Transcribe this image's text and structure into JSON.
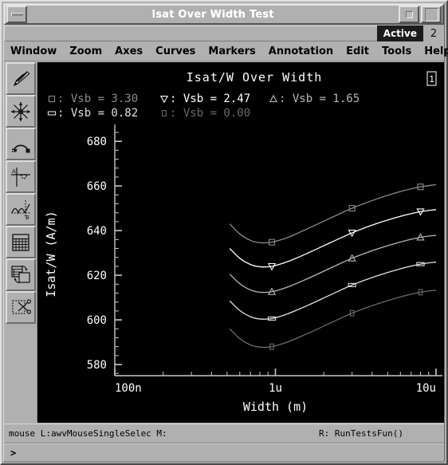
{
  "window": {
    "title": "Isat Over Width Test",
    "minimize_icon": "minimize-icon",
    "maximize_icon": "maximize-icon",
    "restore_icon": "restore-icon"
  },
  "status_strip": {
    "active_label": "Active",
    "window_number": "2"
  },
  "menubar": {
    "items": [
      {
        "label": "Window"
      },
      {
        "label": "Zoom"
      },
      {
        "label": "Axes"
      },
      {
        "label": "Curves"
      },
      {
        "label": "Markers"
      },
      {
        "label": "Annotation"
      },
      {
        "label": "Edit"
      },
      {
        "label": "Tools"
      }
    ],
    "help_label": "Help"
  },
  "toolbar": {
    "items": [
      {
        "icon": "probe-icon",
        "name": "probe-tool"
      },
      {
        "icon": "snap-crosshair-icon",
        "name": "snap-tool"
      },
      {
        "icon": "swap-arrow-icon",
        "name": "swap-tool"
      },
      {
        "icon": "ab-axis-icon",
        "name": "ab-axis-tool"
      },
      {
        "icon": "waveform-b-icon",
        "name": "waveform-b-tool"
      },
      {
        "icon": "table-icon",
        "name": "table-tool"
      },
      {
        "icon": "copy-windows-icon",
        "name": "copy-tool"
      },
      {
        "icon": "scissors-icon",
        "name": "delete-tool"
      }
    ]
  },
  "plot": {
    "corner_label": "1",
    "legend_lines": [
      {
        "marker": "square",
        "text": ":  Vsb  =  3.30",
        "color": "#8a8a8a"
      },
      {
        "marker": "down-triangle",
        "text": ":  Vsb  =  2.47",
        "color": "#ffffff"
      },
      {
        "marker": "up-triangle",
        "text": ":  Vsb  =  1.65",
        "color": "#b8b8b8"
      },
      {
        "marker": "dash",
        "text": ":  Vsb  =  0.82",
        "color": "#e0e0e0"
      },
      {
        "marker": "small-box",
        "text": ":  Vsb  =  0.00",
        "color": "#6a6a6a"
      }
    ]
  },
  "chart_data": {
    "type": "line",
    "title": "Isat/W Over Width",
    "xlabel": "Width (m)",
    "ylabel": "Isat/W (A/m)",
    "xscale": "log",
    "xlim": [
      1e-07,
      1e-05
    ],
    "ylim": [
      575,
      684
    ],
    "xtick_labels": [
      "100n",
      "1u",
      "10u"
    ],
    "xtick_values": [
      1e-07,
      1e-06,
      1e-05
    ],
    "ytick_labels": [
      "580",
      "600",
      "620",
      "640",
      "660",
      "680"
    ],
    "ytick_values": [
      580,
      600,
      620,
      640,
      660,
      680
    ],
    "grid": false,
    "legend_position": "top",
    "series": [
      {
        "name": "Vsb = 3.30",
        "marker": "square",
        "color": "#8a8a8a",
        "x": [
          5.2e-07,
          6e-07,
          7e-07,
          8e-07,
          9.5e-07,
          1.2e-06,
          1.6e-06,
          2.2e-06,
          3e-06,
          4.2e-06,
          6e-06,
          8e-06,
          1e-05
        ],
        "y": [
          643.0,
          638.5,
          635.6,
          634.6,
          634.8,
          637.0,
          641.0,
          645.6,
          650.0,
          654.0,
          657.5,
          659.6,
          660.6
        ]
      },
      {
        "name": "Vsb = 2.47",
        "marker": "down-triangle",
        "color": "#ffffff",
        "x": [
          5.2e-07,
          6e-07,
          7e-07,
          8e-07,
          9.5e-07,
          1.2e-06,
          1.6e-06,
          2.2e-06,
          3e-06,
          4.2e-06,
          6e-06,
          8e-06,
          1e-05
        ],
        "y": [
          632.0,
          627.6,
          624.8,
          623.8,
          624.0,
          626.2,
          630.0,
          634.6,
          639.0,
          643.0,
          646.4,
          648.5,
          649.4
        ]
      },
      {
        "name": "Vsb = 1.65",
        "marker": "up-triangle",
        "color": "#b8b8b8",
        "x": [
          5.2e-07,
          6e-07,
          7e-07,
          8e-07,
          9.5e-07,
          1.2e-06,
          1.6e-06,
          2.2e-06,
          3e-06,
          4.2e-06,
          6e-06,
          8e-06,
          1e-05
        ],
        "y": [
          620.5,
          616.2,
          613.4,
          612.4,
          612.6,
          614.8,
          618.6,
          623.2,
          627.6,
          631.5,
          634.9,
          637.0,
          637.9
        ]
      },
      {
        "name": "Vsb = 0.82",
        "marker": "dash",
        "color": "#e0e0e0",
        "x": [
          5.2e-07,
          6e-07,
          7e-07,
          8e-07,
          9.5e-07,
          1.2e-06,
          1.6e-06,
          2.2e-06,
          3e-06,
          4.2e-06,
          6e-06,
          8e-06,
          1e-05
        ],
        "y": [
          608.5,
          604.2,
          601.4,
          600.4,
          600.6,
          602.8,
          606.6,
          611.2,
          615.6,
          619.5,
          622.9,
          625.0,
          625.9
        ]
      },
      {
        "name": "Vsb = 0.00",
        "marker": "small-box",
        "color": "#6a6a6a",
        "x": [
          5.2e-07,
          6e-07,
          7e-07,
          8e-07,
          9.5e-07,
          1.2e-06,
          1.6e-06,
          2.2e-06,
          3e-06,
          4.2e-06,
          6e-06,
          8e-06,
          1e-05
        ],
        "y": [
          596.0,
          591.6,
          588.8,
          587.8,
          588.0,
          590.2,
          594.0,
          598.6,
          603.0,
          606.9,
          610.3,
          612.4,
          613.3
        ]
      }
    ]
  },
  "status": {
    "mouse_text": "mouse L:awvMouseSingleSelec M:",
    "right_text": "R: RunTestsFun()",
    "prompt": ">"
  },
  "colors": {
    "face": "#b0b0b0",
    "plot_bg": "#000000",
    "axis": "#c8c8c8"
  }
}
